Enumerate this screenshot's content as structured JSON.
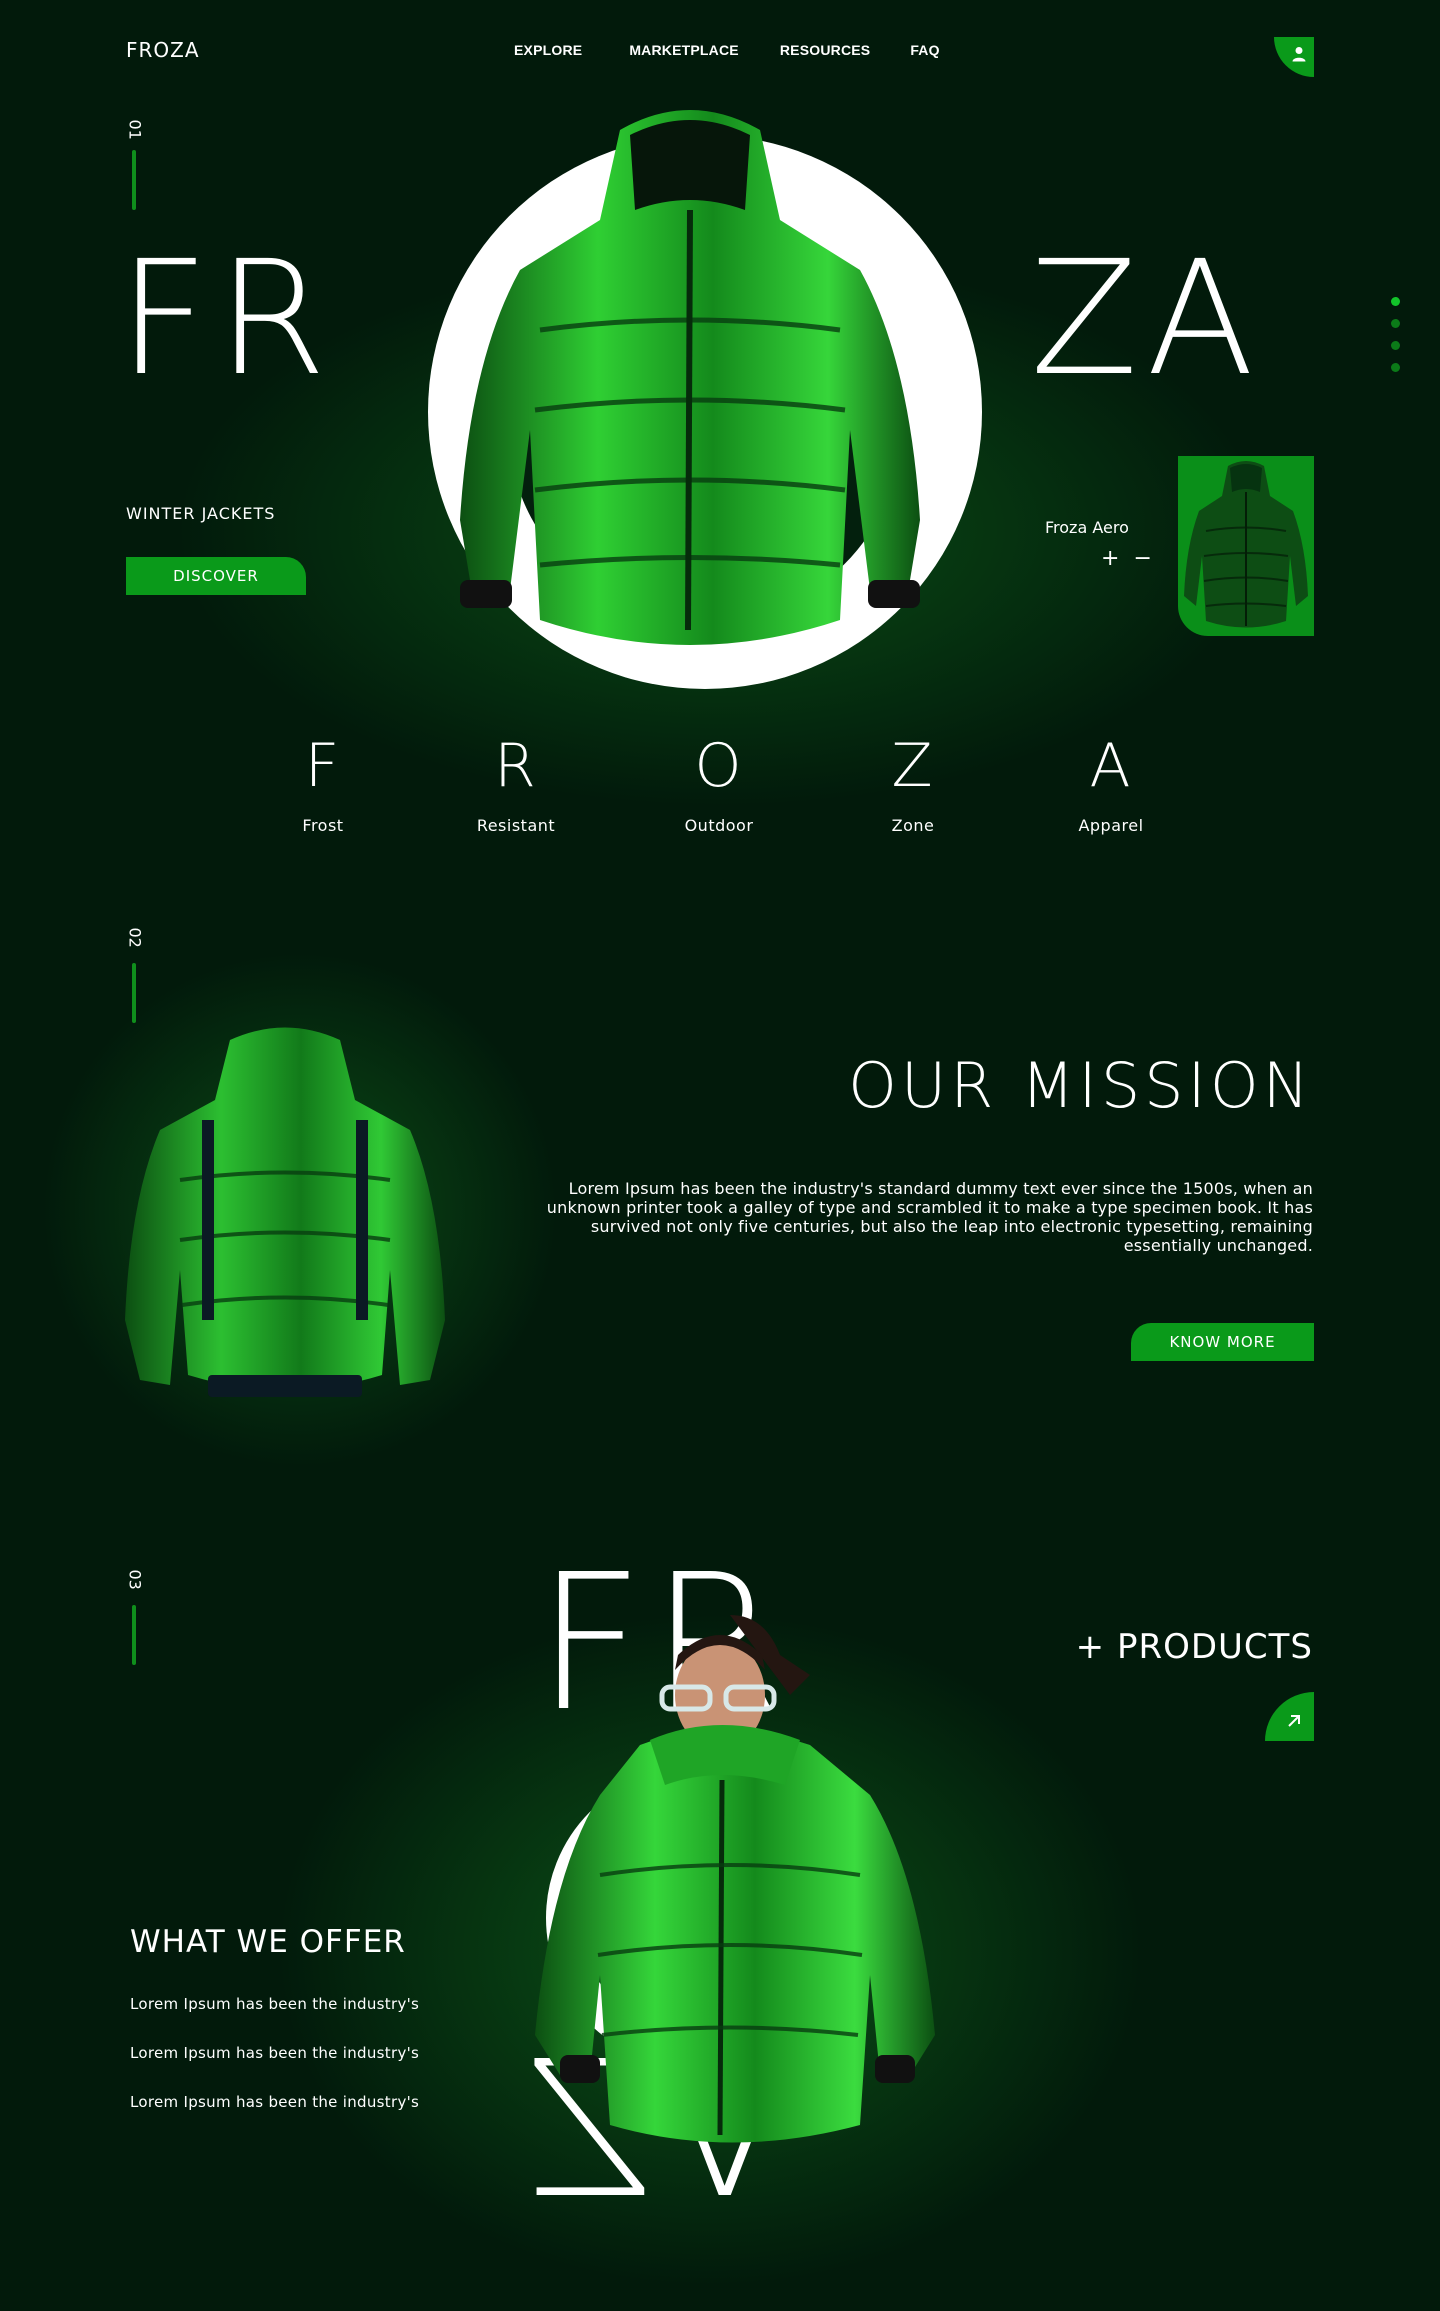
{
  "brand": {
    "logo": "FROZA"
  },
  "nav": {
    "items": [
      "EXPLORE",
      "MARKETPLACE",
      "RESOURCES",
      "FAQ"
    ]
  },
  "sections": {
    "one": "01",
    "two": "02",
    "three": "03"
  },
  "hero": {
    "big_left": "FR",
    "big_right": "ZA",
    "tagline": "WINTER JACKETS",
    "discover_label": "DISCOVER",
    "product_name": "Froza Aero",
    "plus": "+",
    "minus": "−"
  },
  "acronym": [
    {
      "letter": "F",
      "word": "Frost"
    },
    {
      "letter": "R",
      "word": "Resistant"
    },
    {
      "letter": "O",
      "word": "Outdoor"
    },
    {
      "letter": "Z",
      "word": "Zone"
    },
    {
      "letter": "A",
      "word": "Apparel"
    }
  ],
  "mission": {
    "title": "OUR MISSION",
    "text": "Lorem Ipsum has been the industry's standard dummy text ever since the 1500s, when an unknown printer took a galley of type and scrambled it to make a type specimen book. It has survived not only five centuries, but also the leap into electronic typesetting, remaining essentially unchanged.",
    "button_label": "KNOW MORE"
  },
  "products": {
    "big_top": "FR",
    "big_bottom": "ZA",
    "link_label": "+ PRODUCTS",
    "offer_title": "WHAT WE OFFER",
    "offer_items": [
      "Lorem Ipsum has been the industry's",
      "Lorem Ipsum has been the industry's",
      "Lorem Ipsum has been the industry's"
    ]
  },
  "colors": {
    "background": "#021a0b",
    "accent": "#0a9a1a",
    "dot_active": "#12c42a",
    "dot_inactive": "#0b7a18"
  },
  "icons": {
    "user": "user-icon",
    "arrow": "arrow-up-right-icon"
  }
}
